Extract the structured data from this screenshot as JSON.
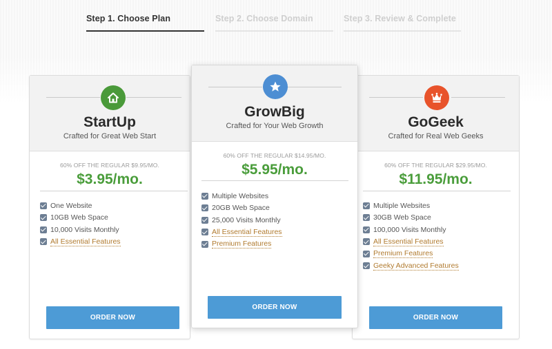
{
  "steps": [
    {
      "label": "Step 1. Choose Plan",
      "active": true
    },
    {
      "label": "Step 2. Choose Domain",
      "active": false
    },
    {
      "label": "Step 3. Review & Complete",
      "active": false
    }
  ],
  "colors": {
    "accent_blue": "#4d9bd6",
    "price_green": "#4a9d3b",
    "startup_badge": "#4a9a3a",
    "growbig_badge": "#4d8ed3",
    "gogeek_badge": "#e8532b",
    "link_orange": "#b07a2e",
    "checkbox": "#6d7e93"
  },
  "plans": [
    {
      "name": "StartUp",
      "tagline": "Crafted for Great Web Start",
      "icon": "home-icon",
      "regular": "60% OFF THE REGULAR $9.95/MO.",
      "price": "$3.95/mo.",
      "features": [
        {
          "label": "One Website",
          "checked": true,
          "link": false
        },
        {
          "label": "10GB Web Space",
          "checked": true,
          "link": false
        },
        {
          "label": "10,000 Visits Monthly",
          "checked": true,
          "link": false
        },
        {
          "label": "All Essential Features",
          "checked": true,
          "link": true
        }
      ],
      "order_label": "ORDER NOW"
    },
    {
      "name": "GrowBig",
      "tagline": "Crafted for Your Web Growth",
      "icon": "star-icon",
      "regular": "60% OFF THE REGULAR $14.95/MO.",
      "price": "$5.95/mo.",
      "features": [
        {
          "label": "Multiple Websites",
          "checked": true,
          "link": false
        },
        {
          "label": "20GB Web Space",
          "checked": true,
          "link": false
        },
        {
          "label": "25,000 Visits Monthly",
          "checked": true,
          "link": false
        },
        {
          "label": "All Essential Features",
          "checked": true,
          "link": true
        },
        {
          "label": "Premium Features",
          "checked": true,
          "link": true
        }
      ],
      "order_label": "ORDER NOW"
    },
    {
      "name": "GoGeek",
      "tagline": "Crafted for Real Web Geeks",
      "icon": "crown-icon",
      "regular": "60% OFF THE REGULAR $29.95/MO.",
      "price": "$11.95/mo.",
      "features": [
        {
          "label": "Multiple Websites",
          "checked": true,
          "link": false
        },
        {
          "label": "30GB Web Space",
          "checked": true,
          "link": false
        },
        {
          "label": "100,000 Visits Monthly",
          "checked": true,
          "link": false
        },
        {
          "label": "All Essential Features",
          "checked": true,
          "link": true
        },
        {
          "label": "Premium Features",
          "checked": true,
          "link": true
        },
        {
          "label": "Geeky Advanced Features",
          "checked": true,
          "link": true
        }
      ],
      "order_label": "ORDER NOW"
    }
  ]
}
